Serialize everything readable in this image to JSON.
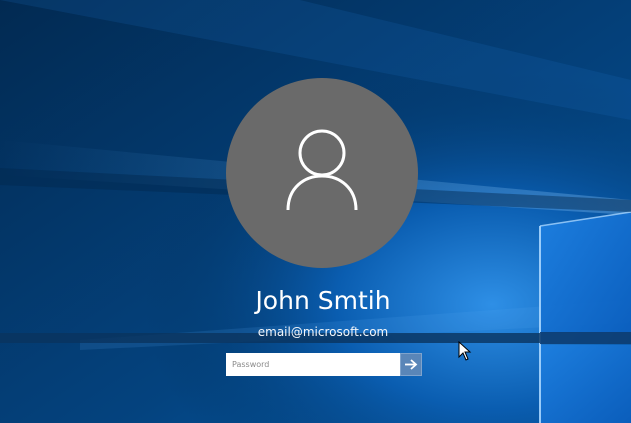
{
  "user": {
    "name": "John Smtih",
    "email": "email@microsoft.com"
  },
  "password": {
    "placeholder": "Password",
    "value": ""
  },
  "submit": {
    "icon": "arrow-right-icon"
  },
  "avatar": {
    "icon": "user-icon"
  },
  "colors": {
    "background": "#02325e",
    "avatar": "#6a6a6a",
    "submit_button": "#5a86b8",
    "text": "#ffffff"
  }
}
